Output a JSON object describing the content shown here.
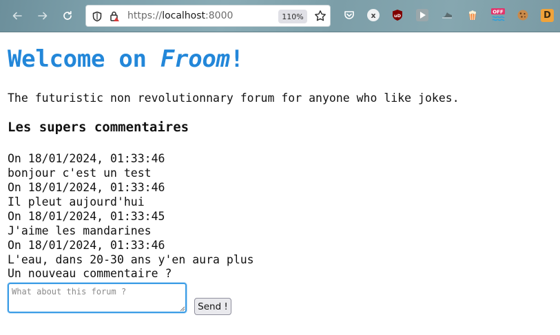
{
  "browser": {
    "url_prefix": "https://",
    "url_host": "localhost",
    "url_port": ":8000",
    "zoom": "110%",
    "extensions": {
      "x_badge": "x",
      "ublock_label": "uD",
      "off_badge": "OFF",
      "d_label": "D"
    }
  },
  "page": {
    "title_prefix": "Welcome on ",
    "title_brand": "Froom",
    "title_suffix": "!",
    "tagline": "The futuristic non revolutionnary forum for anyone who like jokes.",
    "section_title": "Les supers commentaires",
    "comments": [
      {
        "date": "On 18/01/2024, 01:33:46",
        "text": "bonjour c'est un test"
      },
      {
        "date": "On 18/01/2024, 01:33:46",
        "text": "Il pleut aujourd'hui"
      },
      {
        "date": "On 18/01/2024, 01:33:45",
        "text": "J'aime les mandarines"
      },
      {
        "date": "On 18/01/2024, 01:33:46",
        "text": "L'eau, dans 20-30 ans y'en aura plus"
      }
    ],
    "new_comment_label": "Un nouveau commentaire ?",
    "new_comment_placeholder": "What about this forum ?",
    "new_comment_value": "",
    "send_label": "Send !"
  },
  "colors": {
    "title_blue": "#2387d9",
    "input_focus": "#3b9de6"
  }
}
